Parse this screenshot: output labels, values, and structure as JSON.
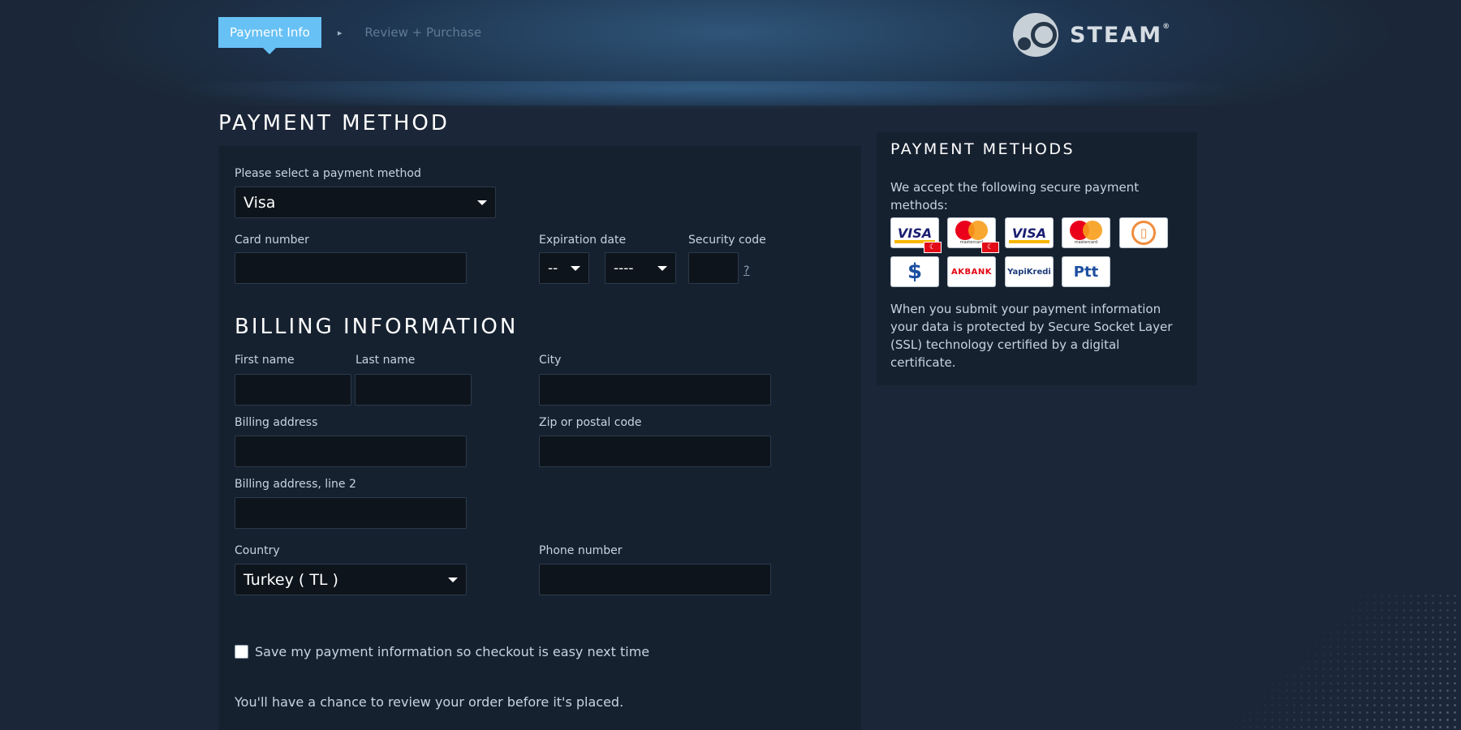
{
  "breadcrumb": {
    "active": "Payment Info",
    "separator": "▸",
    "next": "Review + Purchase"
  },
  "logo": {
    "text": "STEAM",
    "mark": "®"
  },
  "payment": {
    "title": "PAYMENT METHOD",
    "select_label": "Please select a payment method",
    "selected_method": "Visa",
    "card_number_label": "Card number",
    "card_number_value": "",
    "expiration_label": "Expiration date",
    "exp_month": "--",
    "exp_year": "----",
    "security_label": "Security code",
    "security_value": "",
    "security_help": "?"
  },
  "billing": {
    "title": "BILLING INFORMATION",
    "first_name_label": "First name",
    "last_name_label": "Last name",
    "city_label": "City",
    "address_label": "Billing address",
    "zip_label": "Zip or postal code",
    "address2_label": "Billing address, line 2",
    "country_label": "Country",
    "country_value": "Turkey ( TL )",
    "phone_label": "Phone number"
  },
  "save_checkbox": {
    "label": "Save my payment information so checkout is easy next time",
    "checked": false
  },
  "review_note": "You'll have a chance to review your order before it's placed.",
  "sidebar": {
    "title": "PAYMENT METHODS",
    "accept_text": "We accept the following secure payment methods:",
    "ssl_text": "When you submit your payment information your data is protected by Secure Socket Layer (SSL) technology certified by a digital certificate.",
    "methods": {
      "visa": "VISA",
      "mastercard_small": "mastercard",
      "flag": "☾",
      "mobile_icon": "▯",
      "dollar": "$",
      "akbank": "AKBANK",
      "yapi": "YapiKredi",
      "ptt": "Ptt"
    }
  },
  "colors": {
    "background": "#1b2738",
    "panel": "#162130",
    "accent": "#67c1f5",
    "input_bg": "#0e141b"
  }
}
